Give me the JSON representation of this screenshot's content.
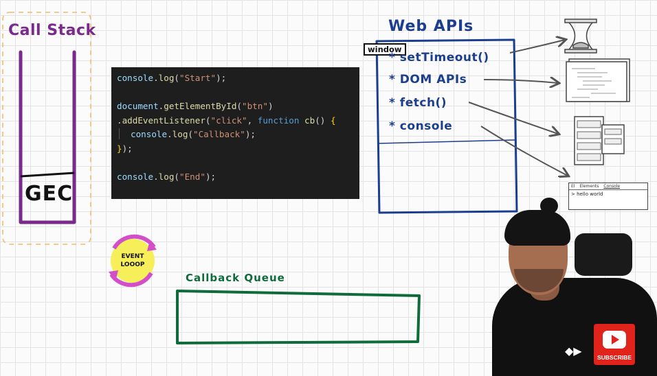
{
  "call_stack": {
    "title": "Call Stack",
    "frame_label": "GEC"
  },
  "code": {
    "lines": [
      [
        {
          "t": "console",
          "c": "c-obj"
        },
        {
          "t": ".",
          "c": ""
        },
        {
          "t": "log",
          "c": "c-fn"
        },
        {
          "t": "(",
          "c": ""
        },
        {
          "t": "\"Start\"",
          "c": "c-str"
        },
        {
          "t": ");",
          "c": ""
        }
      ],
      [],
      [
        {
          "t": "document",
          "c": "c-obj"
        },
        {
          "t": ".",
          "c": ""
        },
        {
          "t": "getElementById",
          "c": "c-fn"
        },
        {
          "t": "(",
          "c": ""
        },
        {
          "t": "\"btn\"",
          "c": "c-str"
        },
        {
          "t": ")",
          "c": ""
        }
      ],
      [
        {
          "t": ".",
          "c": ""
        },
        {
          "t": "addEventListener",
          "c": "c-fn"
        },
        {
          "t": "(",
          "c": ""
        },
        {
          "t": "\"click\"",
          "c": "c-str"
        },
        {
          "t": ", ",
          "c": ""
        },
        {
          "t": "function",
          "c": "c-kw"
        },
        {
          "t": " ",
          "c": ""
        },
        {
          "t": "cb",
          "c": "c-fn"
        },
        {
          "t": "() ",
          "c": ""
        },
        {
          "t": "{",
          "c": "c-br"
        }
      ],
      [
        {
          "t": "INDENT",
          "c": "indent"
        },
        {
          "t": "console",
          "c": "c-obj"
        },
        {
          "t": ".",
          "c": ""
        },
        {
          "t": "log",
          "c": "c-fn"
        },
        {
          "t": "(",
          "c": ""
        },
        {
          "t": "\"Callback\"",
          "c": "c-str"
        },
        {
          "t": ");",
          "c": ""
        }
      ],
      [
        {
          "t": "}",
          "c": "c-br"
        },
        {
          "t": ");",
          "c": ""
        }
      ],
      [],
      [
        {
          "t": "console",
          "c": "c-obj"
        },
        {
          "t": ".",
          "c": ""
        },
        {
          "t": "log",
          "c": "c-fn"
        },
        {
          "t": "(",
          "c": ""
        },
        {
          "t": "\"End\"",
          "c": "c-str"
        },
        {
          "t": ");",
          "c": ""
        }
      ]
    ]
  },
  "web_apis": {
    "title": "Web APIs",
    "window_label": "window",
    "items": [
      "* setTimeout()",
      "* DOM APIs",
      "* fetch()",
      "* console"
    ]
  },
  "event_loop": {
    "line1": "EVENT",
    "line2": "LOOOP"
  },
  "callback_queue": {
    "title": "Callback Queue"
  },
  "devtools": {
    "tabs": [
      "El",
      "Elements",
      "Console"
    ],
    "output": "> hello world"
  },
  "subscribe": {
    "label": "SUBSCRIBE"
  },
  "colors": {
    "call_stack": "#7a2a8c",
    "web_apis": "#1b3e8f",
    "callback_queue": "#0f6b3a",
    "event_loop_fill": "#f7ef5a",
    "event_loop_ring": "#d24fc9",
    "subscribe": "#e0241b"
  }
}
